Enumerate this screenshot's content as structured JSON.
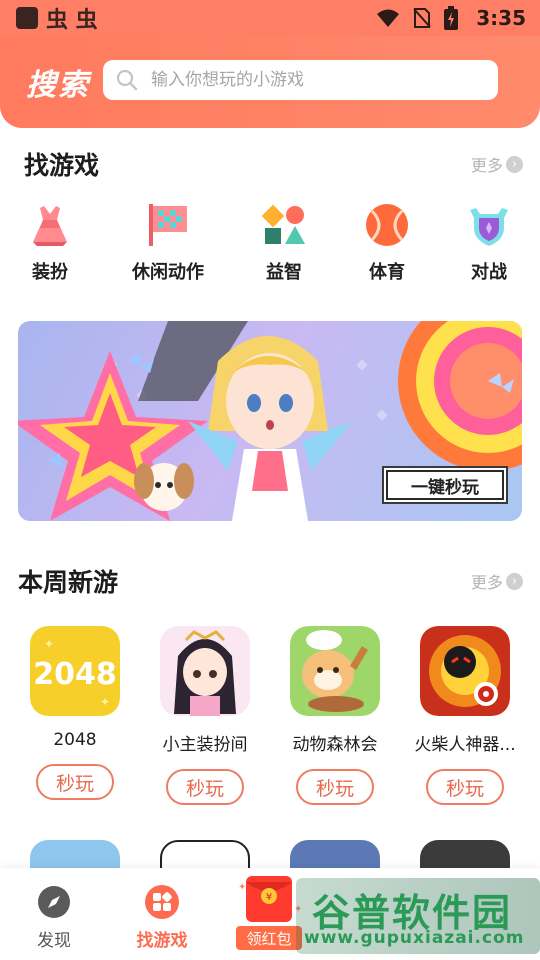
{
  "status_bar": {
    "app_glyphs": "虫 虫",
    "time": "3:35"
  },
  "header": {
    "title": "搜索",
    "search_placeholder": "输入你想玩的小游戏"
  },
  "find_games": {
    "title": "找游戏",
    "more_label": "更多",
    "categories": [
      {
        "label": "装扮",
        "icon": "dress-up-icon"
      },
      {
        "label": "休闲动作",
        "icon": "checkered-flag-icon"
      },
      {
        "label": "益智",
        "icon": "puzzle-shapes-icon"
      },
      {
        "label": "体育",
        "icon": "ball-icon"
      },
      {
        "label": "对战",
        "icon": "shield-icon"
      }
    ]
  },
  "banner": {
    "button_label": "一键秒玩"
  },
  "new_games": {
    "title": "本周新游",
    "more_label": "更多",
    "games": [
      {
        "name": "2048",
        "icon_text": "2048",
        "play_label": "秒玩"
      },
      {
        "name": "小主装扮间",
        "play_label": "秒玩"
      },
      {
        "name": "动物森林会",
        "play_label": "秒玩"
      },
      {
        "name": "火柴人神器...",
        "play_label": "秒玩"
      }
    ]
  },
  "bottom_nav": {
    "items": [
      {
        "label": "发现",
        "icon": "compass-icon"
      },
      {
        "label": "找游戏",
        "icon": "grid-icon"
      }
    ],
    "red_packet_label": "领红包"
  },
  "watermark": {
    "title": "谷普软件园",
    "url": "www.gupuxiazai.com"
  },
  "colors": {
    "accent": "#ff7a5e",
    "play_button": "#ee7b62",
    "nav_active": "#ff6b50"
  }
}
